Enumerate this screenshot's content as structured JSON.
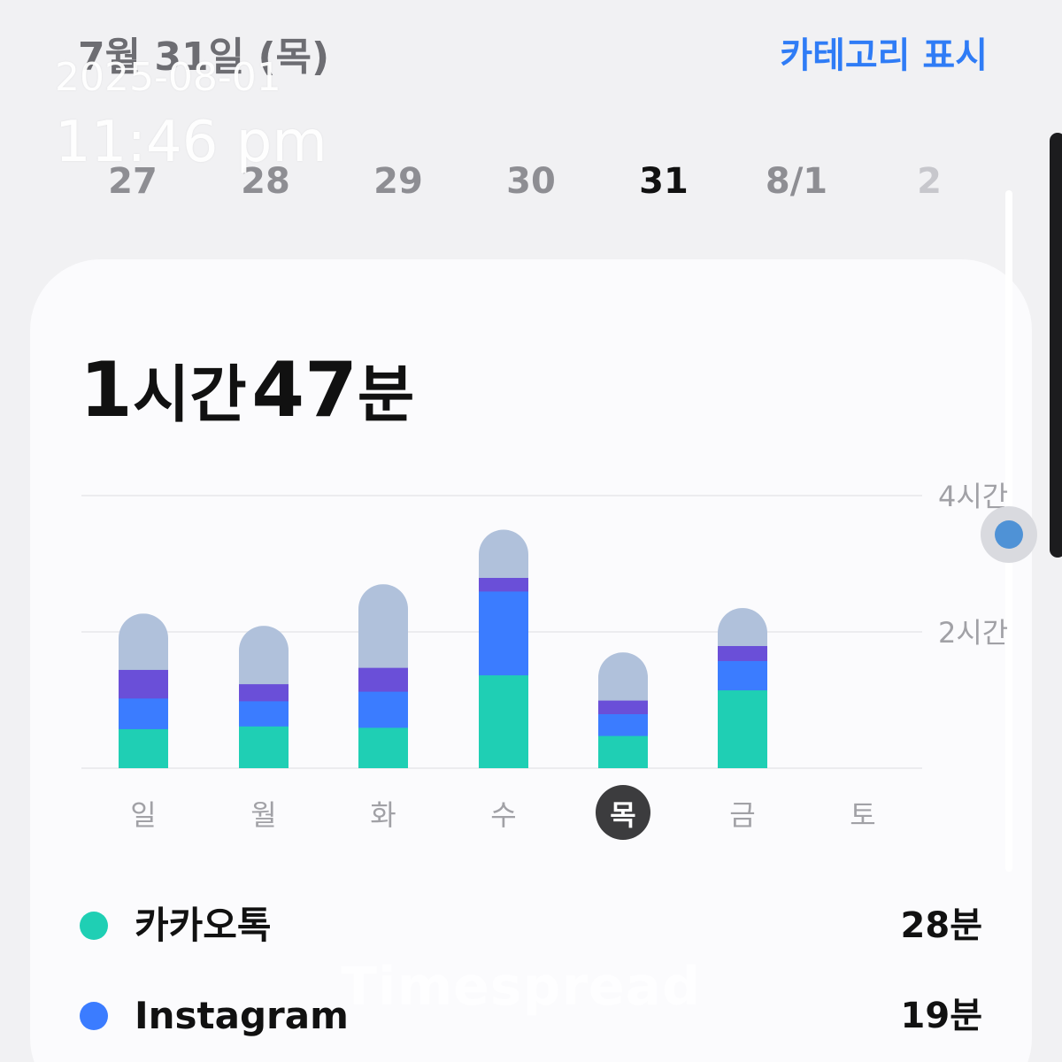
{
  "header": {
    "date": "7월 31일 (목)",
    "action_label": "카테고리 표시",
    "accent_color": "#2f7cf6"
  },
  "watermark": {
    "date": "2025-08-01",
    "time": "11:46 pm",
    "brand": "Timespread"
  },
  "day_strip": [
    {
      "label": "27",
      "state": "normal"
    },
    {
      "label": "28",
      "state": "normal"
    },
    {
      "label": "29",
      "state": "normal"
    },
    {
      "label": "30",
      "state": "normal"
    },
    {
      "label": "31",
      "state": "selected"
    },
    {
      "label": "8/1",
      "state": "normal"
    },
    {
      "label": "2",
      "state": "dim"
    }
  ],
  "summary": {
    "hours": "1",
    "hours_unit": "시간",
    "minutes": "47",
    "minutes_unit": "분"
  },
  "chart_data": {
    "type": "bar",
    "stacked": true,
    "categories": [
      "일",
      "월",
      "화",
      "수",
      "목",
      "금",
      "토"
    ],
    "selected_category": "목",
    "y_unit": "hours",
    "ylim": [
      0,
      4
    ],
    "yticks": [
      {
        "value": 2,
        "label": "2시간"
      },
      {
        "value": 4,
        "label": "4시간"
      }
    ],
    "grid": true,
    "series": [
      {
        "name": "카카오톡",
        "color": "#1fcfb4",
        "values": [
          0.58,
          0.62,
          0.6,
          1.37,
          0.48,
          1.15,
          0
        ]
      },
      {
        "name": "Instagram",
        "color": "#3b7cff",
        "values": [
          0.45,
          0.37,
          0.53,
          1.23,
          0.32,
          0.43,
          0
        ]
      },
      {
        "color": "#6a4fd8",
        "values": [
          0.42,
          0.25,
          0.35,
          0.2,
          0.2,
          0.22,
          0
        ]
      },
      {
        "color": "#b0c1db",
        "values": [
          0.82,
          0.85,
          1.22,
          0.7,
          0.7,
          0.55,
          0
        ]
      }
    ]
  },
  "legend": [
    {
      "name": "카카오톡",
      "value": "28분",
      "color": "#1fcfb4"
    },
    {
      "name": "Instagram",
      "value": "19분",
      "color": "#3b7cff"
    }
  ]
}
